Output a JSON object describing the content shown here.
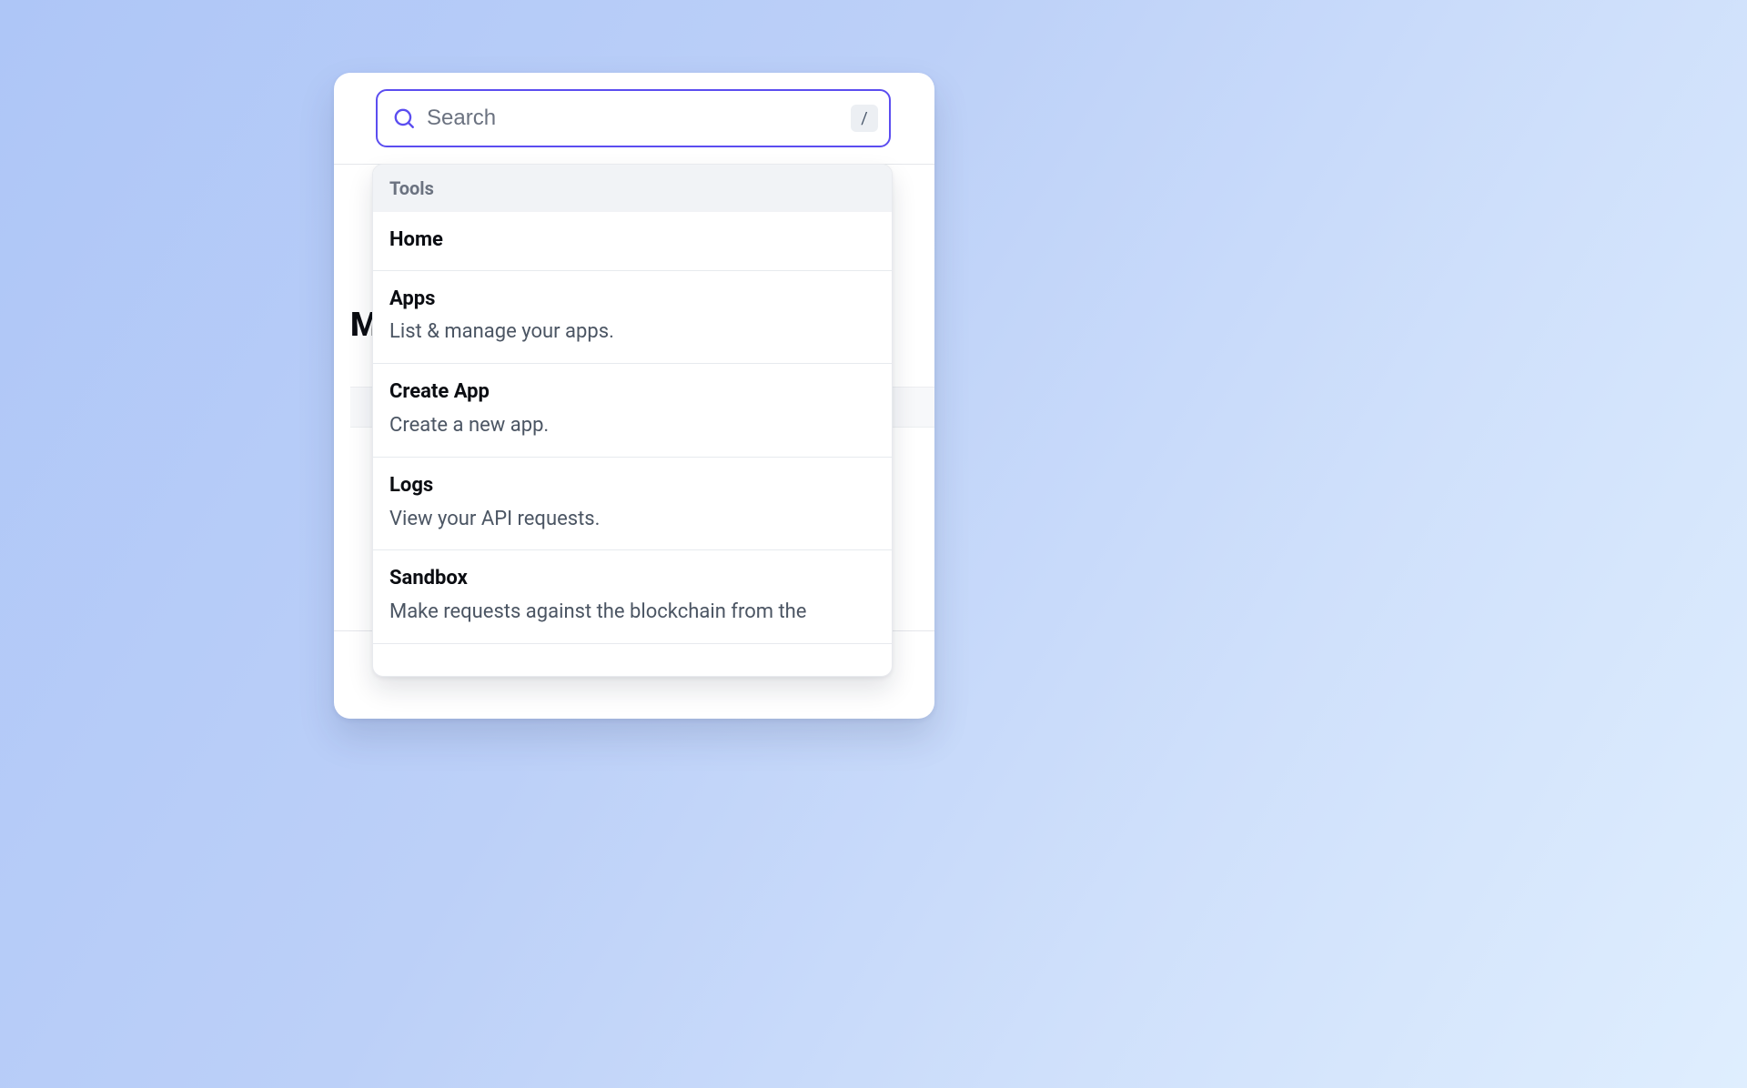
{
  "search": {
    "placeholder": "Search",
    "value": "",
    "shortcut": "/"
  },
  "background": {
    "page_title_fragment": "M"
  },
  "results": {
    "group_label": "Tools",
    "items": [
      {
        "title": "Home",
        "desc": ""
      },
      {
        "title": "Apps",
        "desc": "List & manage your apps."
      },
      {
        "title": "Create App",
        "desc": "Create a new app."
      },
      {
        "title": "Logs",
        "desc": "View your API requests."
      },
      {
        "title": "Sandbox",
        "desc": "Make requests against the blockchain from the"
      }
    ]
  },
  "colors": {
    "accent": "#5b4df0",
    "text_primary": "#0b0d12",
    "text_secondary": "#4b5563",
    "muted": "#6b7280",
    "divider": "#e7eaee",
    "group_bg": "#f1f3f6"
  }
}
